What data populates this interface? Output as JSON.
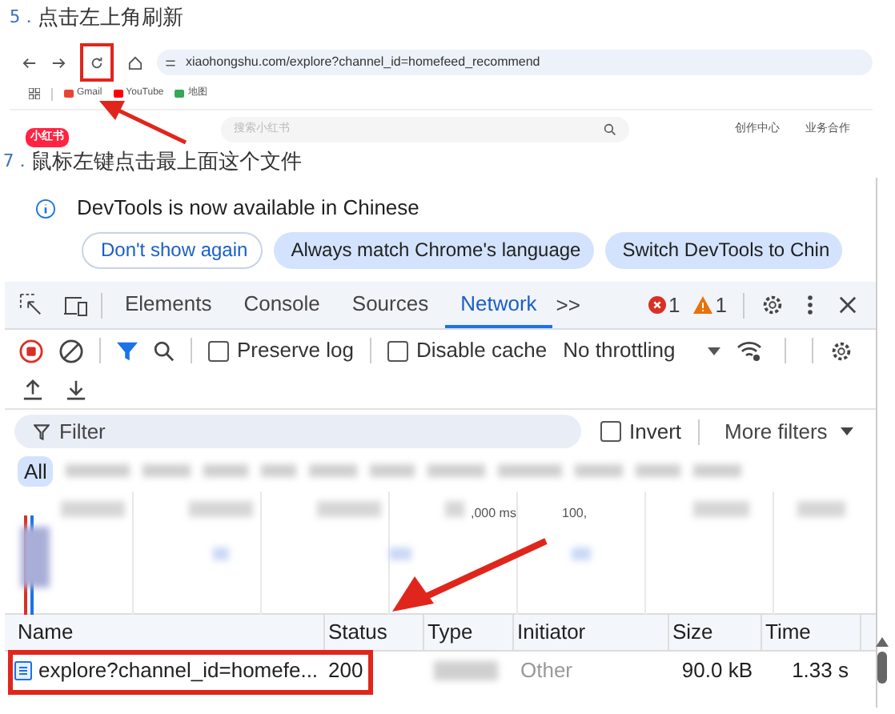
{
  "steps": [
    {
      "number": "5．",
      "text": "点击左上角刷新"
    },
    {
      "number": "7．",
      "text": "鼠标左键点击最上面这个文件"
    }
  ],
  "browser": {
    "url": "xiaohongshu.com/explore?channel_id=homefeed_recommend",
    "bookmarks": [
      {
        "label": "Gmail",
        "color": "#ea4335"
      },
      {
        "label": "YouTube",
        "color": "#ff0000"
      },
      {
        "label": "地图",
        "color": "#34a853"
      }
    ],
    "logo": "小红书",
    "search_placeholder": "搜索小红书",
    "links": [
      "创作中心",
      "业务合作"
    ]
  },
  "devtools": {
    "notice": "DevTools is now available in Chinese",
    "notice_buttons": [
      {
        "label": "Don't show again",
        "kind": "outline"
      },
      {
        "label": "Always match Chrome's language",
        "kind": "filled"
      },
      {
        "label": "Switch DevTools to Chin",
        "kind": "filled"
      }
    ],
    "tabs": [
      {
        "label": "Elements",
        "selected": false
      },
      {
        "label": "Console",
        "selected": false
      },
      {
        "label": "Sources",
        "selected": false
      },
      {
        "label": "Network",
        "selected": true
      }
    ],
    "more_tabs": ">>",
    "errors": "1",
    "warnings": "1",
    "preserve_log": {
      "label": "Preserve log",
      "checked": false
    },
    "disable_cache": {
      "label": "Disable cache",
      "checked": false
    },
    "throttling": "No throttling",
    "filter_placeholder": "Filter",
    "invert": {
      "label": "Invert",
      "checked": false
    },
    "more_filters": "More filters",
    "type_all": "All",
    "timeline_ticks": [
      ",000 ms",
      "100,"
    ],
    "table": {
      "columns": [
        "Name",
        "Status",
        "Type",
        "Initiator",
        "Size",
        "Time"
      ],
      "rows": [
        {
          "name": "explore?channel_id=homefe...",
          "status": "200",
          "initiator": "Other",
          "size": "90.0 kB",
          "time": "1.33 s"
        }
      ]
    }
  }
}
